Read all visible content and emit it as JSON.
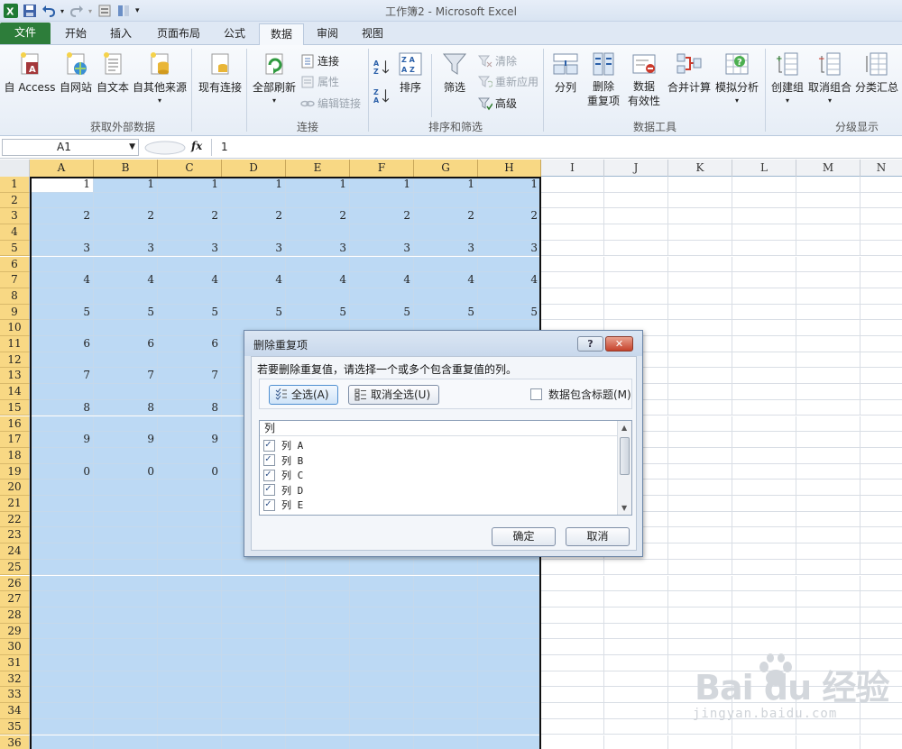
{
  "window": {
    "title": "工作簿2 - Microsoft Excel"
  },
  "tabs": [
    {
      "label": "文件"
    },
    {
      "label": "开始"
    },
    {
      "label": "插入"
    },
    {
      "label": "页面布局"
    },
    {
      "label": "公式"
    },
    {
      "label": "数据"
    },
    {
      "label": "审阅"
    },
    {
      "label": "视图"
    }
  ],
  "ribbon": {
    "external": {
      "access": "自 Access",
      "web": "自网站",
      "text": "自文本",
      "other": "自其他来源",
      "existing": "现有连接",
      "group": "获取外部数据"
    },
    "connections": {
      "refresh_all": "全部刷新",
      "connections": "连接",
      "properties": "属性",
      "edit_links": "编辑链接",
      "group": "连接"
    },
    "sort_filter": {
      "sort_az": "A→Z",
      "sort_za": "Z→A",
      "sort": "排序",
      "filter": "筛选",
      "clear": "清除",
      "reapply": "重新应用",
      "advanced": "高级",
      "group": "排序和筛选"
    },
    "data_tools": {
      "text_to_columns": "分列",
      "remove_dup_1": "删除",
      "remove_dup_2": "重复项",
      "validation_1": "数据",
      "validation_2": "有效性",
      "consolidate": "合并计算",
      "whatif": "模拟分析",
      "group": "数据工具"
    },
    "outline": {
      "group_btn": "创建组",
      "ungroup": "取消组合",
      "subtotal": "分类汇总",
      "group": "分级显示"
    }
  },
  "formula_bar": {
    "name_box": "A1",
    "fx": "fx",
    "value": "1"
  },
  "grid": {
    "columns": [
      "A",
      "B",
      "C",
      "D",
      "E",
      "F",
      "G",
      "H",
      "I",
      "J",
      "K",
      "L",
      "M",
      "N"
    ],
    "rows": [
      "1",
      "2",
      "3",
      "4",
      "5",
      "6",
      "7",
      "8",
      "9",
      "10",
      "11",
      "12",
      "13",
      "14",
      "15",
      "16",
      "17",
      "18",
      "19",
      "20",
      "21",
      "22",
      "23",
      "24",
      "25",
      "26",
      "27",
      "28",
      "29",
      "30",
      "31",
      "32",
      "33",
      "34",
      "35",
      "36"
    ],
    "values": [
      {
        "row": 1,
        "vals": [
          "1",
          "1",
          "1",
          "1",
          "1",
          "1",
          "1",
          "1"
        ]
      },
      {
        "row": 3,
        "vals": [
          "2",
          "2",
          "2",
          "2",
          "2",
          "2",
          "2",
          "2"
        ]
      },
      {
        "row": 5,
        "vals": [
          "3",
          "3",
          "3",
          "3",
          "3",
          "3",
          "3",
          "3"
        ]
      },
      {
        "row": 7,
        "vals": [
          "4",
          "4",
          "4",
          "4",
          "4",
          "4",
          "4",
          "4"
        ]
      },
      {
        "row": 9,
        "vals": [
          "5",
          "5",
          "5",
          "5",
          "5",
          "5",
          "5",
          "5"
        ]
      },
      {
        "row": 11,
        "vals": [
          "6",
          "6",
          "6"
        ]
      },
      {
        "row": 13,
        "vals": [
          "7",
          "7",
          "7"
        ]
      },
      {
        "row": 15,
        "vals": [
          "8",
          "8",
          "8"
        ]
      },
      {
        "row": 17,
        "vals": [
          "9",
          "9",
          "9"
        ]
      },
      {
        "row": 19,
        "vals": [
          "0",
          "0",
          "0"
        ]
      }
    ],
    "selected_columns": [
      "A",
      "B",
      "C",
      "D",
      "E",
      "F",
      "G",
      "H"
    ],
    "colors": {
      "selection": "#bcd9f4",
      "header_highlight": "#f8d884"
    }
  },
  "dialog": {
    "title": "删除重复项",
    "help": "?",
    "close": "✕",
    "instruction": "若要删除重复值，请选择一个或多个包含重复值的列。",
    "select_all": "全选(A)",
    "unselect_all": "取消全选(U)",
    "has_headers": "数据包含标题(M)",
    "has_headers_checked": false,
    "list_header": "列",
    "columns": [
      {
        "label": "列 A",
        "checked": true
      },
      {
        "label": "列 B",
        "checked": true
      },
      {
        "label": "列 C",
        "checked": true
      },
      {
        "label": "列 D",
        "checked": true
      },
      {
        "label": "列 E",
        "checked": true
      }
    ],
    "ok": "确定",
    "cancel": "取消"
  },
  "watermark": {
    "main": "Bai du 经验",
    "sub": "jingyan.baidu.com"
  }
}
